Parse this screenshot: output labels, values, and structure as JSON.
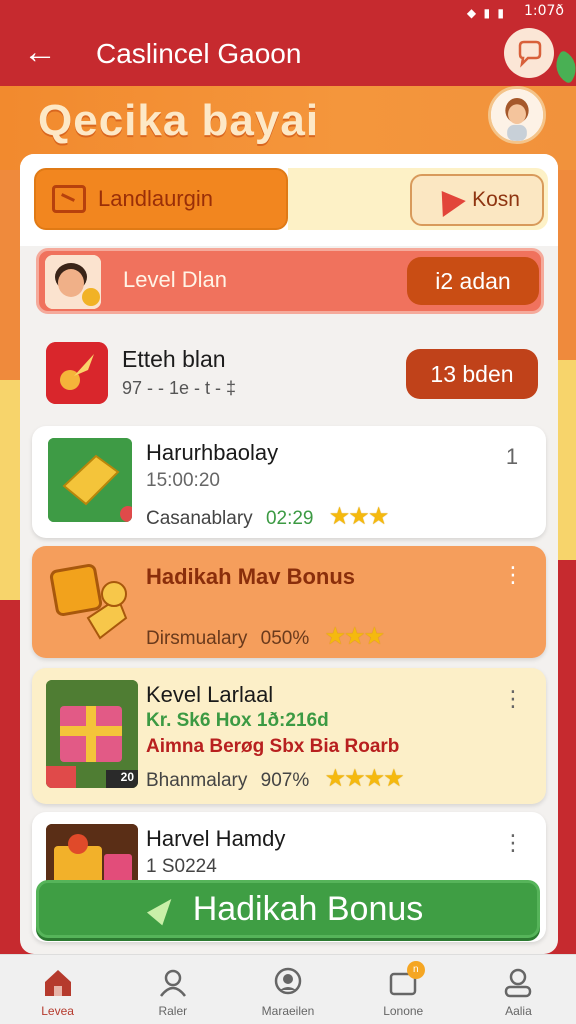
{
  "status": {
    "time": "1:07ð",
    "signal": "◆ ▮ ▮"
  },
  "topbar": {
    "title": "Caslincel Gaoon",
    "back_icon": "arrow-left-icon",
    "chat_icon": "chat-bubble-icon"
  },
  "hero": {
    "title": "Qecika bayai",
    "avatar_icon": "user-avatar-icon"
  },
  "tabs": {
    "left_label": "Landlaurgin",
    "right_label": "Kosn"
  },
  "level_row": {
    "label": "Level Dlan",
    "pill": "i2 adan"
  },
  "row2": {
    "title": "Etteh blan",
    "sub": "97 ‑ ‑ 1e ‑ t ‑ ‡",
    "pill": "13 bden"
  },
  "cards": [
    {
      "title": "Harurhbaolay",
      "line1": "15:00:20",
      "line2_label": "Casanablary",
      "line2_value": "02:29",
      "menu": "1",
      "stars": "★★★"
    },
    {
      "title": "Hadikah Mav Bonus",
      "line2_label": "Dirsmualary",
      "line2_value": "050%",
      "menu": "⋮",
      "stars": "★★★"
    },
    {
      "title": "Kevel Larlaal",
      "line1": "Kr. Sk6 Hox 1ð:216d",
      "line2": "Aimna Berøg Sbx Bia Roarb",
      "line3_label": "Bhanmalary",
      "line3_value": "907%",
      "menu": "⋮",
      "stars": "★★★★",
      "thumb_badge": "20"
    },
    {
      "title": "Harvel Hamdy",
      "line1": "1 S0224",
      "menu": "⋮"
    }
  ],
  "cta": {
    "label": "Hadikah Bonus"
  },
  "nav": [
    {
      "label": "Levea",
      "icon": "home-icon"
    },
    {
      "label": "Raler",
      "icon": "profile-icon"
    },
    {
      "label": "Maraeilen",
      "icon": "chat-icon"
    },
    {
      "label": "Lonone",
      "icon": "inbox-icon",
      "badge": "n"
    },
    {
      "label": "Aalia",
      "icon": "account-icon"
    }
  ],
  "colors": {
    "brand_red": "#c62a2f",
    "orange": "#f2861f",
    "green": "#3f9e44",
    "star": "#f5b90e"
  }
}
